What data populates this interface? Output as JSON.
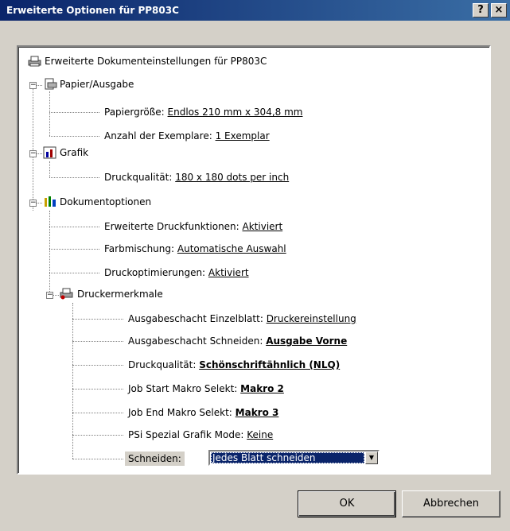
{
  "window": {
    "title": "Erweiterte Optionen für PP803C",
    "help_label": "?",
    "close_label": "×"
  },
  "tree": {
    "root": "Erweiterte Dokumenteinstellungen für PP803C",
    "papier": {
      "label": "Papier/Ausgabe",
      "papiergroesse_label": "Papiergröße: ",
      "papiergroesse_value": "Endlos 210 mm x 304,8 mm",
      "exemplare_label": "Anzahl der Exemplare: ",
      "exemplare_value": "1 Exemplar"
    },
    "grafik": {
      "label": "Grafik",
      "druckqualitaet_label": "Druckqualität: ",
      "druckqualitaet_value": "180 x 180 dots per inch"
    },
    "dokumentoptionen": {
      "label": "Dokumentoptionen",
      "erweiterte_label": "Erweiterte Druckfunktionen: ",
      "erweiterte_value": "Aktiviert",
      "farbmischung_label": "Farbmischung: ",
      "farbmischung_value": "Automatische Auswahl",
      "optimierung_label": "Druckoptimierungen: ",
      "optimierung_value": "Aktiviert"
    },
    "druckermerkmale": {
      "label": "Druckermerkmale",
      "einzelblatt_label": "Ausgabeschacht Einzelblatt: ",
      "einzelblatt_value": "Druckereinstellung",
      "schneiden_schacht_label": "Ausgabeschacht Schneiden: ",
      "schneiden_schacht_value": "Ausgabe Vorne",
      "qualitaet_label": "Druckqualität: ",
      "qualitaet_value": "Schönschriftähnlich (NLQ)",
      "jobstart_label": "Job Start Makro Selekt: ",
      "jobstart_value": "Makro 2",
      "jobend_label": "Job End Makro Selekt: ",
      "jobend_value": "Makro 3",
      "psi_label": "PSi Spezial Grafik Mode: ",
      "psi_value": "Keine",
      "schneiden_label": "Schneiden:",
      "schneiden_value": "Jedes Blatt schneiden"
    }
  },
  "buttons": {
    "ok": "OK",
    "cancel": "Abbrechen"
  }
}
